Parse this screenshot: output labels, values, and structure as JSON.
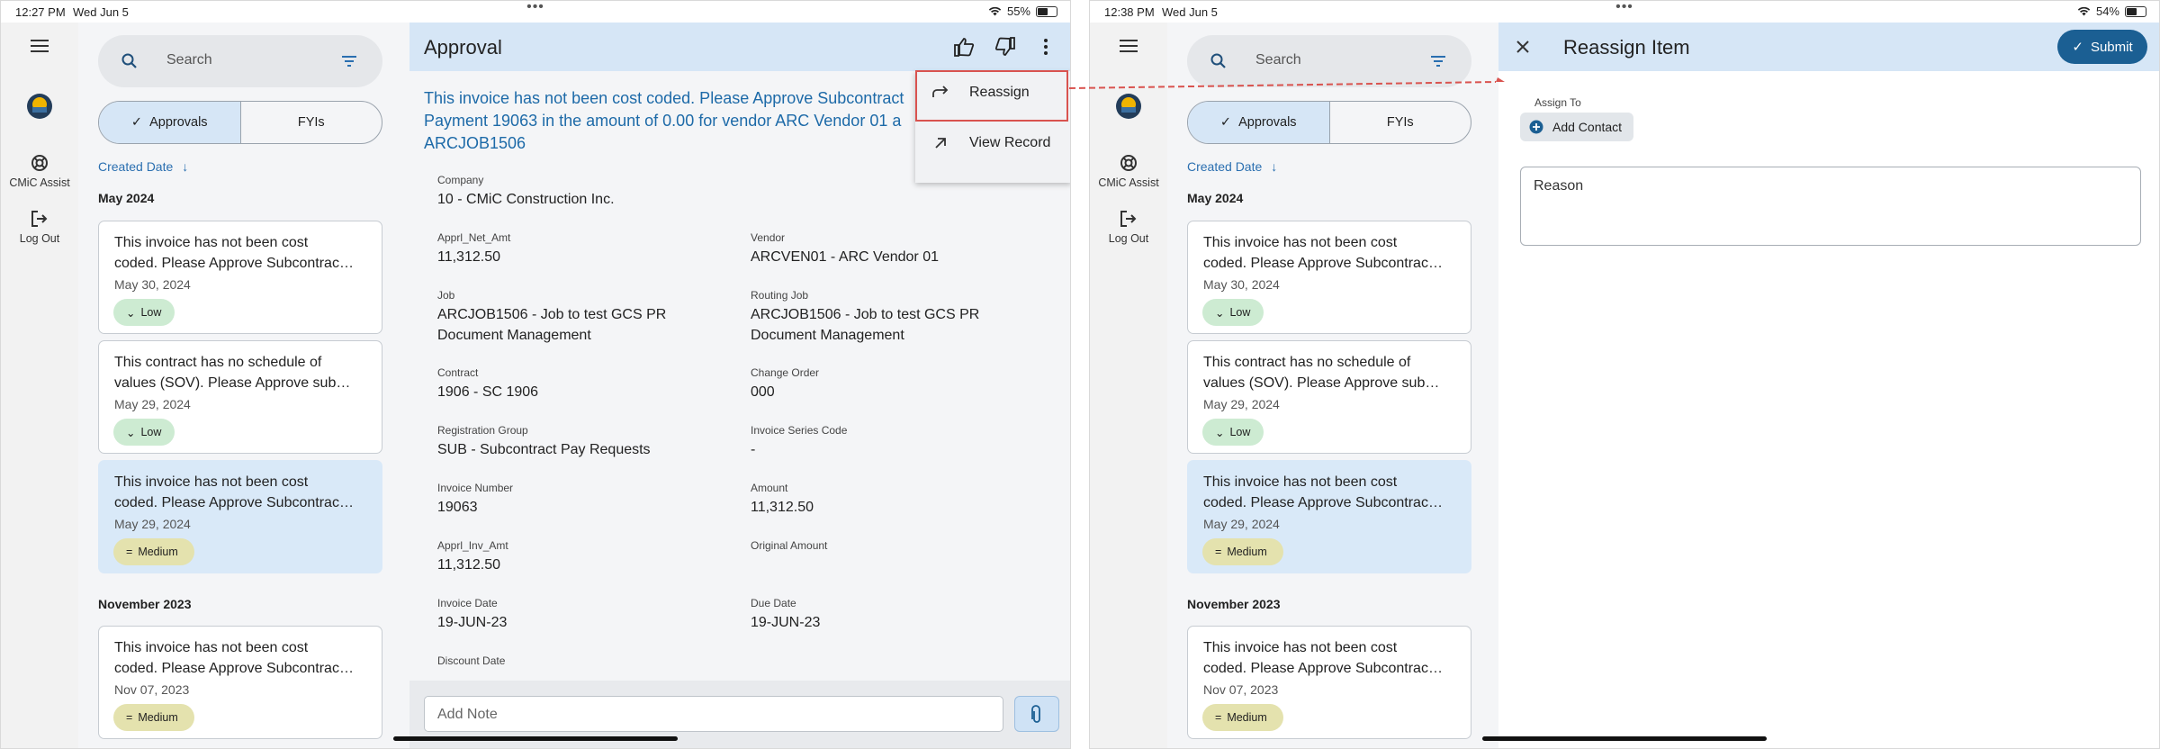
{
  "status_left": {
    "time": "12:27 PM",
    "date": "Wed Jun 5",
    "battery": "55%",
    "battery_level": 0.55
  },
  "status_right": {
    "time": "12:38 PM",
    "date": "Wed Jun 5",
    "battery": "54%",
    "battery_level": 0.54
  },
  "rail": {
    "assist_label": "CMiC Assist",
    "logout_label": "Log Out"
  },
  "list": {
    "search_placeholder": "Search",
    "tabs": [
      "Approvals",
      "FYIs"
    ],
    "sort_label": "Created Date",
    "groups": [
      "May 2024",
      "November 2023"
    ],
    "cards": [
      {
        "line1": "This invoice has not been cost",
        "line2": "coded. Please Approve Subcontrac…",
        "date": "May 30, 2024",
        "priority": "Low"
      },
      {
        "line1": "This contract has no schedule of",
        "line2": "values (SOV).  Please Approve sub…",
        "date": "May 29, 2024",
        "priority": "Low"
      },
      {
        "line1": "This invoice has not been cost",
        "line2": "coded. Please Approve Subcontrac…",
        "date": "May 29, 2024",
        "priority": "Medium"
      },
      {
        "line1": "This invoice has not been cost",
        "line2": "coded. Please Approve Subcontrac…",
        "date": "Nov 07, 2023",
        "priority": "Medium"
      }
    ]
  },
  "approval": {
    "title": "Approval",
    "lead_line1": "This invoice has not been cost coded. Please Approve Subcontract",
    "lead_line2": "Payment 19063 in the amount of 0.00 for vendor ARC Vendor 01 a",
    "lead_line3": "ARCJOB1506",
    "fields": {
      "company": {
        "label": "Company",
        "value": "10 - CMiC Construction Inc."
      },
      "apri_net_amt": {
        "label": "Apprl_Net_Amt",
        "value": "11,312.50"
      },
      "vendor": {
        "label": "Vendor",
        "value": "ARCVEN01 - ARC Vendor 01"
      },
      "job": {
        "label": "Job",
        "value1": "ARCJOB1506 - Job to test GCS PR",
        "value2": "Document Management"
      },
      "routing_job": {
        "label": "Routing Job",
        "value1": "ARCJOB1506 - Job to test GCS PR",
        "value2": "Document Management"
      },
      "contract": {
        "label": "Contract",
        "value": "1906 - SC 1906"
      },
      "change_order": {
        "label": "Change Order",
        "value": "000"
      },
      "registration_group": {
        "label": "Registration Group",
        "value": "SUB - Subcontract Pay Requests"
      },
      "invoice_series_code": {
        "label": "Invoice Series Code",
        "value": "-"
      },
      "invoice_number": {
        "label": "Invoice Number",
        "value": "19063"
      },
      "amount": {
        "label": "Amount",
        "value": "11,312.50"
      },
      "apri_inv_amt": {
        "label": "Apprl_Inv_Amt",
        "value": "11,312.50"
      },
      "original_amount": {
        "label": "Original Amount",
        "value": ""
      },
      "invoice_date": {
        "label": "Invoice Date",
        "value": "19-JUN-23"
      },
      "due_date": {
        "label": "Due Date",
        "value": "19-JUN-23"
      },
      "discount_date": {
        "label": "Discount Date",
        "value": ""
      }
    },
    "note_placeholder": "Add Note",
    "menu": [
      "Reassign",
      "View Record"
    ]
  },
  "reassign": {
    "title": "Reassign Item",
    "submit_label": "Submit",
    "assign_to_label": "Assign To",
    "add_contact_label": "Add Contact",
    "reason_placeholder": "Reason"
  },
  "colors": {
    "accent": "#1b5f93",
    "header_bg": "#d6e6f6",
    "highlight": "#d9534f",
    "link": "#1d6aa8"
  }
}
